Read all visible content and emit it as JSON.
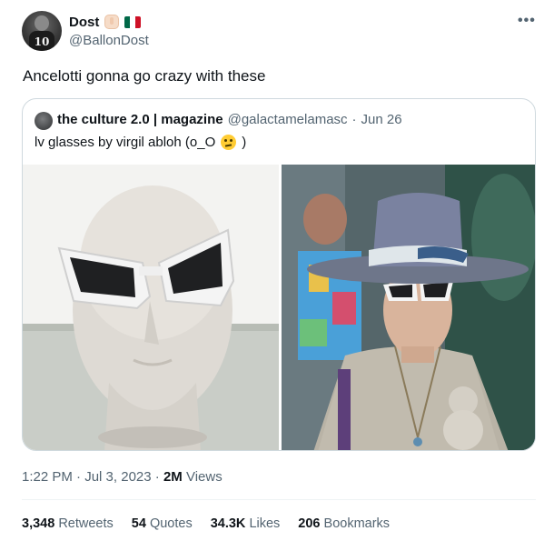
{
  "author": {
    "display_name": "Dost",
    "handle": "@BallonDost",
    "avatar_number": "10",
    "badges": [
      "hand-emoji",
      "mexico-flag-emoji"
    ]
  },
  "tweet": {
    "text": "Ancelotti gonna go crazy with these",
    "more_icon": "•••"
  },
  "quoted": {
    "name": "the culture 2.0 | magazine",
    "handle": "@galactamelamasc",
    "separator": "·",
    "date": "Jun 26",
    "text": "lv glasses by virgil abloh (o_O",
    "text_end": ")",
    "emoji": "thinking-face-emoji",
    "images": [
      "mannequin-head-white-sunglasses",
      "model-hat-white-sunglasses"
    ]
  },
  "meta": {
    "time": "1:22 PM",
    "sep1": "·",
    "date": "Jul 3, 2023",
    "sep2": "·",
    "views_count": "2M",
    "views_label": "Views"
  },
  "stats": {
    "retweets_count": "3,348",
    "retweets_label": "Retweets",
    "quotes_count": "54",
    "quotes_label": "Quotes",
    "likes_count": "34.3K",
    "likes_label": "Likes",
    "bookmarks_count": "206",
    "bookmarks_label": "Bookmarks"
  },
  "colors": {
    "text_primary": "#0f1419",
    "text_secondary": "#536471",
    "border": "#cfd9de"
  }
}
